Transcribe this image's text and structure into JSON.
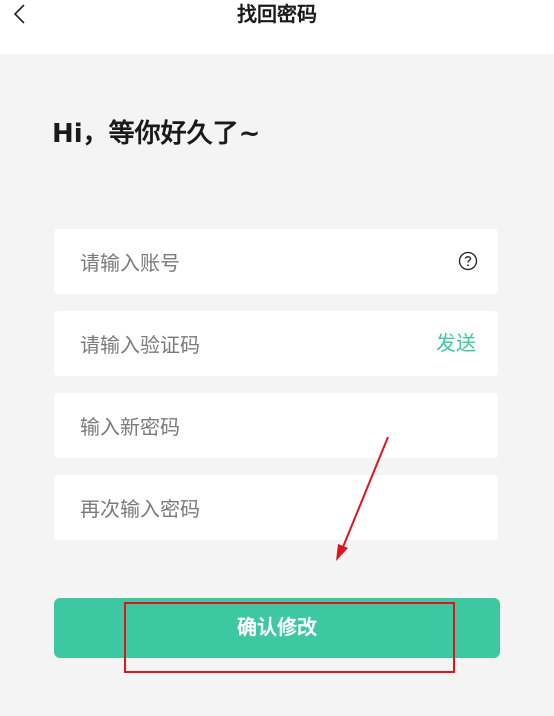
{
  "header": {
    "title": "找回密码",
    "back_icon": "chevron-left-icon"
  },
  "greeting": "Hi，等你好久了~",
  "form": {
    "account_placeholder": "请输入账号",
    "help_icon": "question-circle-icon",
    "code_placeholder": "请输入验证码",
    "send_label": "发送",
    "new_password_placeholder": "输入新密码",
    "repeat_password_placeholder": "再次输入密码"
  },
  "confirm_button": "确认修改",
  "colors": {
    "accent": "#3dc8a2",
    "annotation": "#e0151b",
    "background": "#f4f4f4"
  }
}
